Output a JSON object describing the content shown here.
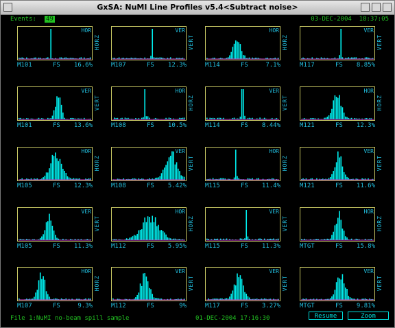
{
  "window": {
    "title": "GxSA: NuMI Line Profiles v5.4<Subtract noise>"
  },
  "header": {
    "events_label": "Events:",
    "events_value": "49",
    "datetime": "03-DEC-2004  18:37:05"
  },
  "footer": {
    "file_text": "File 1:NuMI no-beam spill sample",
    "file_datetime": "01-DEC-2004 17:16:30",
    "resume_label": "Resume",
    "zoom_label": "Zoom"
  },
  "colors": {
    "bar": "#00f0f0",
    "frame": "#c8c864",
    "baseline_noise": "#d040d0",
    "text_green": "#22c022",
    "text_cyan": "#22c0e0"
  },
  "panels": [
    {
      "name": "M101",
      "fs": "FS",
      "pct": "16.6%",
      "tag": "HOR",
      "axis": "HORZ",
      "profile": {
        "type": "spike",
        "pos": 0.45,
        "height": 1.0
      }
    },
    {
      "name": "M107",
      "fs": "FS",
      "pct": "12.3%",
      "tag": "VER",
      "axis": "VERT",
      "profile": {
        "type": "spike",
        "pos": 0.55,
        "height": 1.0
      }
    },
    {
      "name": "M114",
      "fs": "FS",
      "pct": "7.1%",
      "tag": "HOR",
      "axis": "HORZ",
      "profile": {
        "type": "gauss",
        "pos": 0.42,
        "width": 0.05,
        "height": 0.9
      }
    },
    {
      "name": "M117",
      "fs": "FS",
      "pct": "8.85%",
      "tag": "VER",
      "axis": "VERT",
      "profile": {
        "type": "spike",
        "pos": 0.55,
        "height": 1.0
      }
    },
    {
      "name": "M101",
      "fs": "FS",
      "pct": "13.6%",
      "tag": "VER",
      "axis": "VERT",
      "profile": {
        "type": "gauss",
        "pos": 0.55,
        "width": 0.04,
        "height": 0.9
      }
    },
    {
      "name": "M108",
      "fs": "FS",
      "pct": "10.5%",
      "tag": "HOR",
      "axis": "HORZ",
      "profile": {
        "type": "spike",
        "pos": 0.45,
        "height": 1.0
      }
    },
    {
      "name": "M114",
      "fs": "FS",
      "pct": "8.44%",
      "tag": "VER",
      "axis": "VERT",
      "profile": {
        "type": "spike",
        "pos": 0.5,
        "height": 1.0
      }
    },
    {
      "name": "M121",
      "fs": "FS",
      "pct": "12.3%",
      "tag": "HOR",
      "axis": "HORZ",
      "profile": {
        "type": "gauss",
        "pos": 0.5,
        "width": 0.06,
        "height": 0.95
      }
    },
    {
      "name": "M105",
      "fs": "FS",
      "pct": "12.3%",
      "tag": "HOR",
      "axis": "HORZ",
      "profile": {
        "type": "gauss",
        "pos": 0.52,
        "width": 0.08,
        "height": 1.0
      }
    },
    {
      "name": "M108",
      "fs": "FS",
      "pct": "5.42%",
      "tag": "VER",
      "axis": "VERT",
      "profile": {
        "type": "gauss",
        "pos": 0.82,
        "width": 0.08,
        "height": 1.0
      }
    },
    {
      "name": "M115",
      "fs": "FS",
      "pct": "11.4%",
      "tag": "HOR",
      "axis": "HORZ",
      "profile": {
        "type": "spike",
        "pos": 0.4,
        "height": 1.0
      }
    },
    {
      "name": "M121",
      "fs": "FS",
      "pct": "11.6%",
      "tag": "VER",
      "axis": "VERT",
      "profile": {
        "type": "gauss",
        "pos": 0.52,
        "width": 0.05,
        "height": 1.0
      }
    },
    {
      "name": "M105",
      "fs": "FS",
      "pct": "11.3%",
      "tag": "VER",
      "axis": "VERT",
      "profile": {
        "type": "gauss",
        "pos": 0.42,
        "width": 0.05,
        "height": 1.0
      }
    },
    {
      "name": "M112",
      "fs": "FS",
      "pct": "5.95%",
      "tag": "HOR",
      "axis": "HORZ",
      "profile": {
        "type": "gauss",
        "pos": 0.52,
        "width": 0.12,
        "height": 0.9
      }
    },
    {
      "name": "M115",
      "fs": "FS",
      "pct": "11.3%",
      "tag": "VER",
      "axis": "VERT",
      "profile": {
        "type": "spike",
        "pos": 0.55,
        "height": 1.0
      }
    },
    {
      "name": "MTGT",
      "fs": "FS",
      "pct": "15.8%",
      "tag": "HOR",
      "axis": "HORZ",
      "profile": {
        "type": "gauss",
        "pos": 0.52,
        "width": 0.05,
        "height": 1.0
      }
    },
    {
      "name": "M107",
      "fs": "FS",
      "pct": "9.3%",
      "tag": "HOR",
      "axis": "HORZ",
      "profile": {
        "type": "gauss",
        "pos": 0.32,
        "width": 0.05,
        "height": 1.0
      }
    },
    {
      "name": "M112",
      "fs": "FS",
      "pct": "9%",
      "tag": "VER",
      "axis": "VERT",
      "profile": {
        "type": "gauss",
        "pos": 0.45,
        "width": 0.06,
        "height": 0.95
      }
    },
    {
      "name": "M117",
      "fs": "FS",
      "pct": "3.27%",
      "tag": "VER",
      "axis": "VERT",
      "profile": {
        "type": "gauss",
        "pos": 0.45,
        "width": 0.06,
        "height": 0.95
      }
    },
    {
      "name": "MTGT",
      "fs": "FS",
      "pct": "9.81%",
      "tag": "VER",
      "axis": "VERT",
      "profile": {
        "type": "gauss",
        "pos": 0.55,
        "width": 0.06,
        "height": 0.95
      }
    }
  ]
}
